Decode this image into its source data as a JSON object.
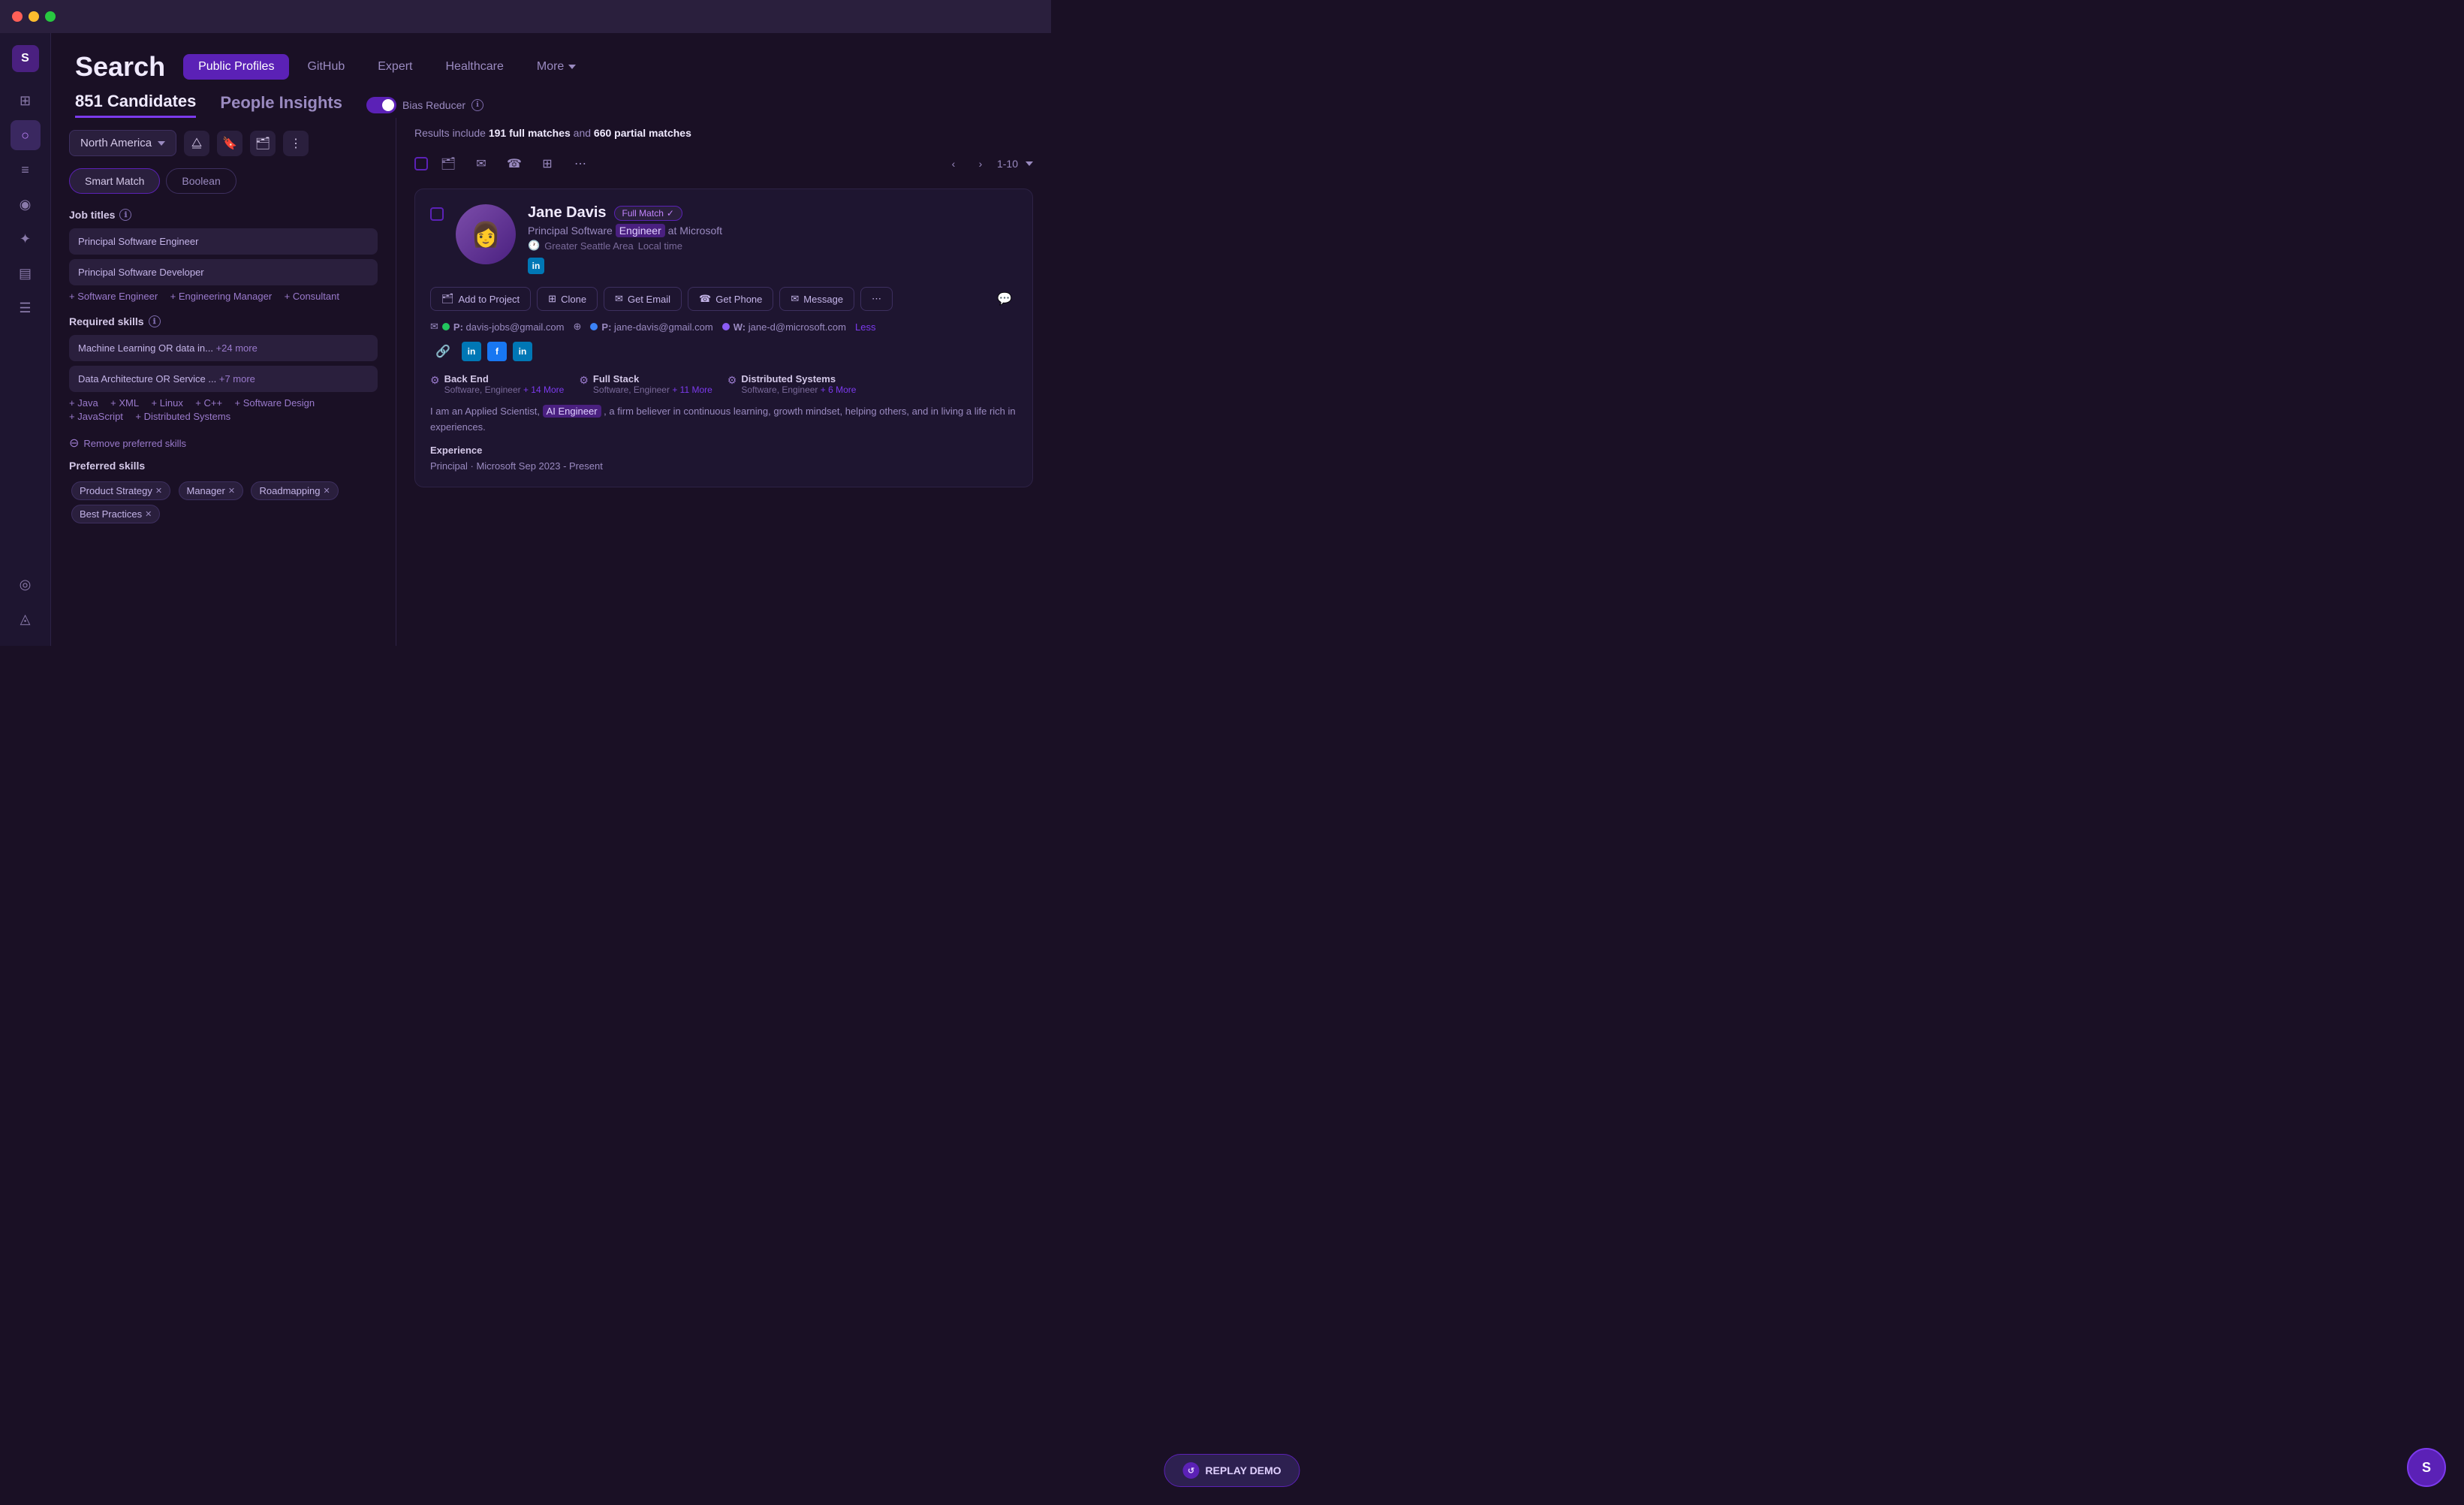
{
  "titleBar": {
    "dots": [
      "red",
      "yellow",
      "green"
    ]
  },
  "sidebar": {
    "logo": "S",
    "icons": [
      {
        "name": "grid-icon",
        "symbol": "⊞",
        "active": false
      },
      {
        "name": "search-icon",
        "symbol": "○",
        "active": true
      },
      {
        "name": "bar-chart-icon",
        "symbol": "≡",
        "active": false
      },
      {
        "name": "contact-icon",
        "symbol": "◉",
        "active": false
      },
      {
        "name": "star-icon",
        "symbol": "✦",
        "active": false
      },
      {
        "name": "message-icon",
        "symbol": "▤",
        "active": false
      },
      {
        "name": "filter-icon",
        "symbol": "☰",
        "active": false
      }
    ],
    "bottomIcons": [
      {
        "name": "user-icon",
        "symbol": "◎"
      },
      {
        "name": "bell-icon",
        "symbol": "◬"
      }
    ]
  },
  "header": {
    "title": "Search",
    "tabs": [
      {
        "label": "Public Profiles",
        "active": true
      },
      {
        "label": "GitHub",
        "active": false
      },
      {
        "label": "Expert",
        "active": false
      },
      {
        "label": "Healthcare",
        "active": false
      },
      {
        "label": "More",
        "active": false,
        "hasChevron": true
      }
    ]
  },
  "subHeader": {
    "tabs": [
      {
        "label": "851 Candidates",
        "active": true
      },
      {
        "label": "People Insights",
        "active": false
      }
    ],
    "biasReducer": {
      "label": "Bias Reducer",
      "infoIcon": "ℹ",
      "enabled": true
    }
  },
  "leftPanel": {
    "region": "North America",
    "resultsSummary": {
      "prefix": "Results include ",
      "fullMatches": "191 full matches",
      "and": " and ",
      "partialMatches": "660 partial matches"
    },
    "matchTabs": [
      {
        "label": "Smart Match",
        "active": true
      },
      {
        "label": "Boolean",
        "active": false
      }
    ],
    "jobTitles": {
      "sectionTitle": "Job titles",
      "items": [
        "Principal Software Engineer",
        "Principal Software Developer"
      ],
      "addLinks": [
        "+ Software Engineer",
        "+ Engineering Manager",
        "+ Consultant"
      ]
    },
    "requiredSkills": {
      "sectionTitle": "Required skills",
      "items": [
        {
          "text": "Machine Learning OR data in...",
          "more": "+24 more"
        },
        {
          "text": "Data Architecture OR Service ...",
          "more": "+7 more"
        }
      ],
      "addLinks": [
        "Java",
        "XML",
        "Linux",
        "C++",
        "Software Design",
        "JavaScript",
        "Distributed Systems"
      ]
    },
    "removePreferredSkills": "Remove preferred skills",
    "preferredSkills": {
      "sectionTitle": "Preferred skills",
      "tags": [
        {
          "label": "Product Strategy"
        },
        {
          "label": "Manager"
        },
        {
          "label": "Roadmapping"
        },
        {
          "label": "Best Practices"
        }
      ]
    }
  },
  "rightPanel": {
    "toolbar": {
      "checkbox": "",
      "folder": "🗂",
      "email": "✉",
      "phone": "☎",
      "copy": "⊞",
      "more": "⋯"
    },
    "pagination": {
      "prev": "<",
      "next": ">",
      "range": "1-10"
    },
    "candidate": {
      "name": "Jane Davis",
      "matchBadge": "Full Match",
      "title": "Principal Software",
      "titleHighlight": "Engineer",
      "company": "at Microsoft",
      "location": "Greater Seattle Area",
      "localTime": "Local time",
      "emails": [
        {
          "type": "P",
          "address": "davis-jobs@gmail.com",
          "verified": true
        },
        {
          "type": "P",
          "address": "jane-davis@gmail.com",
          "verified": true
        },
        {
          "type": "W",
          "address": "jane-d@microsoft.com",
          "verified": true
        }
      ],
      "lessLink": "Less",
      "skills": [
        {
          "icon": "⚙",
          "name": "Back End",
          "sub": "Software, Engineer",
          "more": "+ 14 More"
        },
        {
          "icon": "⚙",
          "name": "Full Stack",
          "sub": "Software, Engineer",
          "more": "+ 11 More"
        },
        {
          "icon": "⚙",
          "name": "Distributed Systems",
          "sub": "Software, Engineer",
          "more": "+ 6 More"
        }
      ],
      "bio": "I am an Applied Scientist,",
      "bioHighlight": "AI Engineer",
      "bioRest": ", a firm believer in continuous learning, growth mindset, helping others, and in living a life rich in experiences.",
      "experience": {
        "label": "Experience",
        "item": "Principal",
        "company": "Microsoft",
        "date": "Sep 2023 - Present"
      },
      "actions": [
        {
          "label": "Add to Project",
          "icon": "🗂"
        },
        {
          "label": "Clone",
          "icon": "⊞"
        },
        {
          "label": "Get Email",
          "icon": "✉"
        },
        {
          "label": "Get Phone",
          "icon": "☎"
        },
        {
          "label": "Message",
          "icon": "✉"
        },
        {
          "label": "More",
          "icon": "⋯"
        }
      ]
    }
  },
  "replayDemo": {
    "label": "REPLAY DEMO"
  },
  "avatarBtn": {
    "label": "S"
  }
}
